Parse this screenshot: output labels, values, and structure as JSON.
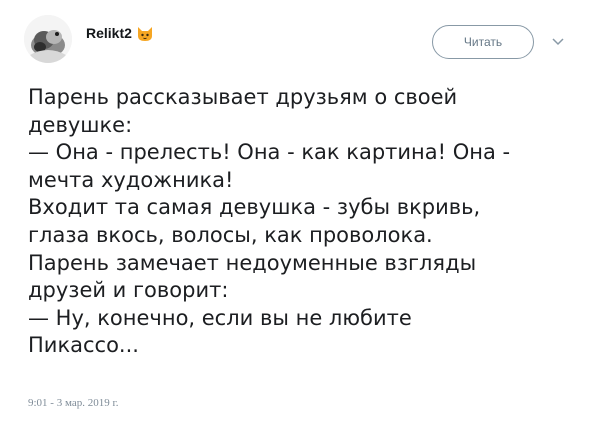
{
  "author": {
    "username": "Relikt2",
    "badge_icon": "cat-face-icon"
  },
  "header": {
    "follow_label": "Читать",
    "more_icon": "chevron-down-icon"
  },
  "tweet": {
    "lines": [
      "Парень рассказывает друзьям о своей",
      "девушке:",
      "— Она - прелесть! Она - как картина! Она -",
      "мечта художника!",
      "Входит та самая девушка - зубы вкривь,",
      "глаза вкось, волосы, как проволока.",
      "Парень замечает недоуменные взгляды",
      "друзей и говорит:",
      "— Ну, конечно, если вы не любите",
      "Пикассо..."
    ],
    "timestamp": "9:01 - 3 мар. 2019 г."
  },
  "colors": {
    "text": "#1c1e21",
    "secondary": "#657786",
    "badge": "#f6a623"
  }
}
